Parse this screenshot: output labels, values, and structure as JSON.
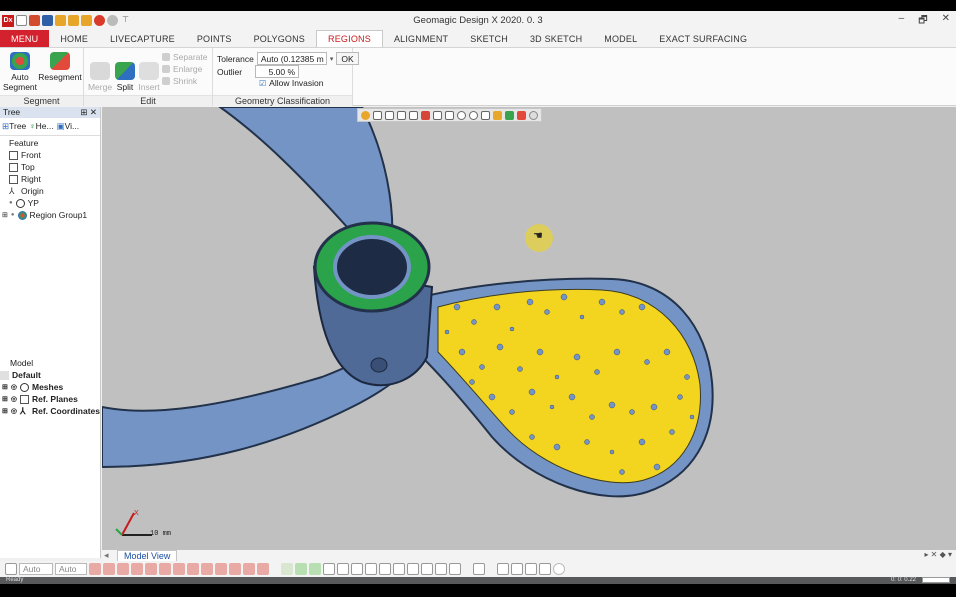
{
  "window": {
    "title": "Geomagic Design X 2020. 0. 3",
    "logo": "Dx",
    "minimize": "–",
    "restore": "🗗",
    "close": "✕"
  },
  "tabs": [
    {
      "label": "MENU",
      "state": "menu"
    },
    {
      "label": "HOME"
    },
    {
      "label": "LIVECAPTURE"
    },
    {
      "label": "POINTS"
    },
    {
      "label": "POLYGONS"
    },
    {
      "label": "REGIONS",
      "state": "active"
    },
    {
      "label": "ALIGNMENT"
    },
    {
      "label": "SKETCH"
    },
    {
      "label": "3D SKETCH"
    },
    {
      "label": "MODEL"
    },
    {
      "label": "EXACT SURFACING"
    }
  ],
  "ribbon": {
    "segment": {
      "auto_line1": "Auto",
      "auto_line2": "Segment",
      "resegment": "Resegment",
      "label": "Segment"
    },
    "edit": {
      "merge": "Merge",
      "split": "Split",
      "insert": "Insert",
      "separate": "Separate",
      "enlarge": "Enlarge",
      "shrink": "Shrink",
      "label": "Edit"
    },
    "geometry": {
      "tolerance_label": "Tolerance",
      "tolerance_value": "Auto (0.12385 m",
      "outlier_label": "Outlier",
      "outlier_value": "5.00 %",
      "ok": "OK",
      "allow_invasion": "Allow Invasion",
      "label": "Geometry Classification"
    }
  },
  "tree_panel": {
    "title": "Tree",
    "pin": "⊞ ✕",
    "tabs": [
      "Tree",
      "He...",
      "Vi..."
    ],
    "section": "Feature",
    "items": [
      "Front",
      "Top",
      "Right",
      "Origin",
      "YP",
      "Region Group1"
    ]
  },
  "model_panel": {
    "section": "Model",
    "items": [
      "Default",
      "Meshes",
      "Ref. Planes",
      "Ref. Coordinates"
    ]
  },
  "viewport": {
    "scale_label": "10 mm",
    "triad_x": "X"
  },
  "view_tabs": {
    "active": "Model View",
    "right_controls": "▸ ✕ ◆ ▾"
  },
  "bottom_toolbar": {
    "mode1": "Auto",
    "mode2": "Auto"
  },
  "status": {
    "text": "Ready",
    "coords": "0:  0:  0.22"
  },
  "colors": {
    "menu_red": "#d3212d",
    "mesh_blue": "#7494c6",
    "region_yellow": "#f3d51f",
    "ring_green": "#2aa34a",
    "viewport_bg": "#c0c0c0"
  }
}
